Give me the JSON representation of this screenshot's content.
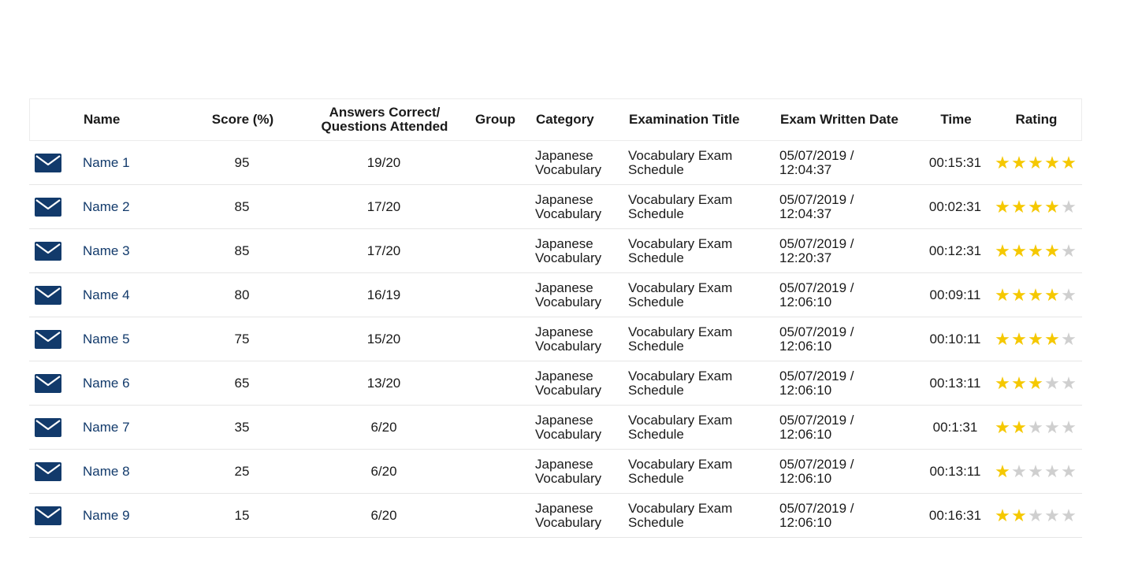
{
  "colors": {
    "accent": "#123a6b",
    "star_filled": "#f5c800",
    "star_empty": "#cfcfcf"
  },
  "icons": {
    "row_action": "mail-icon",
    "rating": "star-icon"
  },
  "table": {
    "headers": {
      "name": "Name",
      "score": "Score (%)",
      "answers_line1": "Answers Correct/",
      "answers_line2": "Questions Attended",
      "group": "Group",
      "category": "Category",
      "exam_title": "Examination Title",
      "exam_date": "Exam Written Date",
      "time": "Time",
      "rating": "Rating"
    },
    "rows": [
      {
        "name": "Name 1",
        "score": "95",
        "answers": "19/20",
        "group": "",
        "category_line1": "Japanese",
        "category_line2": "Vocabulary",
        "title_line1": "Vocabulary Exam",
        "title_line2": "Schedule",
        "date_line1": "05/07/2019 /",
        "date_line2": "12:04:37",
        "time": "00:15:31",
        "rating": 5
      },
      {
        "name": "Name 2",
        "score": "85",
        "answers": "17/20",
        "group": "",
        "category_line1": "Japanese",
        "category_line2": "Vocabulary",
        "title_line1": "Vocabulary Exam",
        "title_line2": "Schedule",
        "date_line1": "05/07/2019 /",
        "date_line2": "12:04:37",
        "time": "00:02:31",
        "rating": 4
      },
      {
        "name": "Name 3",
        "score": "85",
        "answers": "17/20",
        "group": "",
        "category_line1": "Japanese",
        "category_line2": "Vocabulary",
        "title_line1": "Vocabulary Exam",
        "title_line2": "Schedule",
        "date_line1": "05/07/2019 /",
        "date_line2": "12:20:37",
        "time": "00:12:31",
        "rating": 4
      },
      {
        "name": "Name 4",
        "score": "80",
        "answers": "16/19",
        "group": "",
        "category_line1": "Japanese",
        "category_line2": "Vocabulary",
        "title_line1": "Vocabulary Exam",
        "title_line2": "Schedule",
        "date_line1": "05/07/2019 /",
        "date_line2": "12:06:10",
        "time": "00:09:11",
        "rating": 4
      },
      {
        "name": "Name 5",
        "score": "75",
        "answers": "15/20",
        "group": "",
        "category_line1": "Japanese",
        "category_line2": "Vocabulary",
        "title_line1": "Vocabulary Exam",
        "title_line2": "Schedule",
        "date_line1": "05/07/2019 /",
        "date_line2": "12:06:10",
        "time": "00:10:11",
        "rating": 4
      },
      {
        "name": "Name 6",
        "score": "65",
        "answers": "13/20",
        "group": "",
        "category_line1": "Japanese",
        "category_line2": "Vocabulary",
        "title_line1": "Vocabulary Exam",
        "title_line2": "Schedule",
        "date_line1": "05/07/2019 /",
        "date_line2": "12:06:10",
        "time": "00:13:11",
        "rating": 3
      },
      {
        "name": "Name 7",
        "score": "35",
        "answers": "6/20",
        "group": "",
        "category_line1": "Japanese",
        "category_line2": "Vocabulary",
        "title_line1": "Vocabulary Exam",
        "title_line2": "Schedule",
        "date_line1": "05/07/2019 /",
        "date_line2": "12:06:10",
        "time": "00:1:31",
        "rating": 2
      },
      {
        "name": "Name 8",
        "score": "25",
        "answers": "6/20",
        "group": "",
        "category_line1": "Japanese",
        "category_line2": "Vocabulary",
        "title_line1": "Vocabulary Exam",
        "title_line2": "Schedule",
        "date_line1": "05/07/2019 /",
        "date_line2": "12:06:10",
        "time": "00:13:11",
        "rating": 1
      },
      {
        "name": "Name 9",
        "score": "15",
        "answers": "6/20",
        "group": "",
        "category_line1": "Japanese",
        "category_line2": "Vocabulary",
        "title_line1": "Vocabulary Exam",
        "title_line2": "Schedule",
        "date_line1": "05/07/2019 /",
        "date_line2": "12:06:10",
        "time": "00:16:31",
        "rating": 2
      }
    ]
  }
}
